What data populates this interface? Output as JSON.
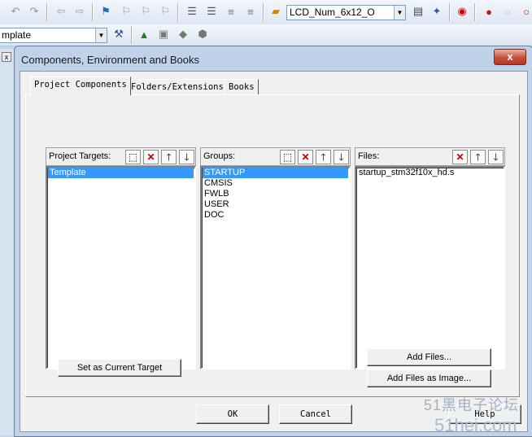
{
  "toolbar": {
    "target_combo_value": "LCD_Num_6x12_O",
    "project_combo_value": "mplate"
  },
  "dialog": {
    "title": "Components, Environment and Books",
    "close_glyph": "x",
    "tabs": [
      {
        "label": "Project Components",
        "active": true
      },
      {
        "label": "Folders/Extensions",
        "active": false
      },
      {
        "label": "Books",
        "active": false
      }
    ],
    "targets": {
      "header": "Project Targets:",
      "items": [
        "Template"
      ],
      "selected": 0
    },
    "groups": {
      "header": "Groups:",
      "items": [
        "STARTUP",
        "CMSIS",
        "FWLB",
        "USER",
        "DOC"
      ],
      "selected": 0
    },
    "files": {
      "header": "Files:",
      "items": [
        "startup_stm32f10x_hd.s"
      ]
    },
    "buttons": {
      "set_current_target": "Set as Current Target",
      "add_files": "Add Files...",
      "add_files_as_image": "Add Files as Image...",
      "ok": "OK",
      "cancel": "Cancel",
      "help": "Help"
    }
  },
  "watermark": {
    "line1": "51黑电子论坛",
    "line2": "51hei.com"
  }
}
